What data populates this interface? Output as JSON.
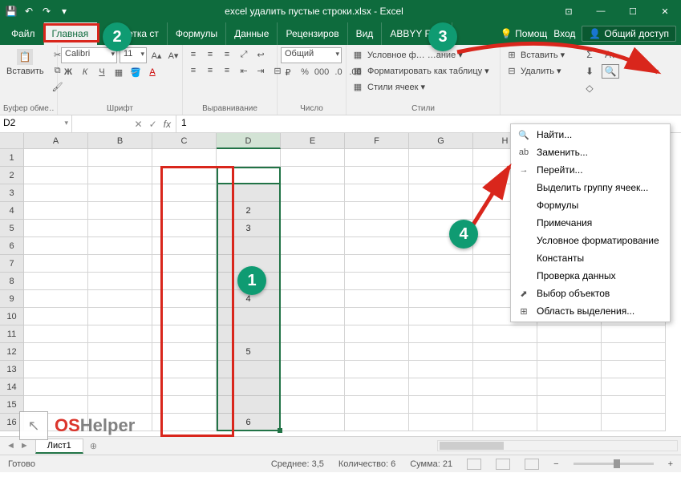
{
  "title": "excel удалить пустые строки.xlsx - Excel",
  "tabs": {
    "file": "Файл",
    "home": "Главная",
    "pagelayout": "Разметка ст",
    "formulas": "Формулы",
    "data": "Данные",
    "review": "Рецензиров",
    "view": "Вид",
    "abbyy": "ABBYY Fine",
    "tellme": "Помощ",
    "signin": "Вход",
    "share": "Общий доступ"
  },
  "ribbon": {
    "clipboard": {
      "label": "Буфер обме…",
      "paste": "Вставить"
    },
    "font": {
      "label": "Шрифт",
      "name": "Calibri",
      "size": "11"
    },
    "alignment": {
      "label": "Выравнивание"
    },
    "number": {
      "label": "Число",
      "format": "Общий"
    },
    "styles": {
      "label": "Стили",
      "cond": "Условное ф…        …ание ▾",
      "table": "Форматировать как таблицу ▾",
      "cell": "Стили ячеек ▾"
    },
    "cells": {
      "insert": "Вставить ▾",
      "delete": "Удалить ▾"
    },
    "editing": {
      "sum": "Σ",
      "fill": "⬇",
      "clear": "◇",
      "sort": "A↓",
      "find": "🔍"
    }
  },
  "namebox": "D2",
  "formula": "1",
  "columns": [
    "A",
    "B",
    "C",
    "D",
    "E",
    "F",
    "G",
    "H",
    "I",
    "J"
  ],
  "rows_count": 16,
  "selected_col_index": 3,
  "data_cells": {
    "2": "1",
    "4": "2",
    "5": "3",
    "9": "4",
    "12": "5",
    "16": "6"
  },
  "menu": [
    {
      "icon": "🔍",
      "label": "Найти..."
    },
    {
      "icon": "ab",
      "label": "Заменить..."
    },
    {
      "icon": "→",
      "label": "Перейти..."
    },
    {
      "icon": "",
      "label": "Выделить группу ячеек..."
    },
    {
      "icon": "",
      "label": "Формулы"
    },
    {
      "icon": "",
      "label": "Примечания"
    },
    {
      "icon": "",
      "label": "Условное форматирование"
    },
    {
      "icon": "",
      "label": "Константы"
    },
    {
      "icon": "",
      "label": "Проверка данных"
    },
    {
      "icon": "⬈",
      "label": "Выбор объектов"
    },
    {
      "icon": "⊞",
      "label": "Область выделения..."
    }
  ],
  "sheet": "Лист1",
  "status": {
    "ready": "Готово",
    "avg": "Среднее: 3,5",
    "count": "Количество: 6",
    "sum": "Сумма: 21",
    "zoom": "+"
  },
  "annotations": {
    "b1": "1",
    "b2": "2",
    "b3": "3",
    "b4": "4"
  },
  "watermark": {
    "os": "OS",
    "helper": "Helper"
  }
}
